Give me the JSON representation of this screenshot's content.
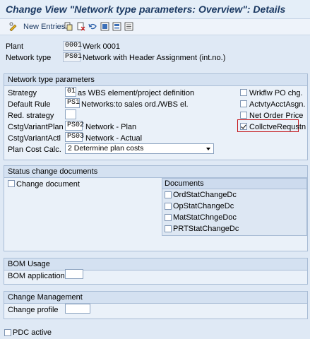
{
  "window": {
    "title": "Change View \"Network type parameters: Overview\": Details"
  },
  "toolbar": {
    "new_entries": "New Entries"
  },
  "header": {
    "plant_label": "Plant",
    "plant_code": "0001",
    "plant_name": "Werk 0001",
    "network_type_label": "Network type",
    "network_type_code": "PS01",
    "network_type_name": "Network with Header Assignment (int.no.)"
  },
  "ntp": {
    "title": "Network type parameters",
    "strategy_label": "Strategy",
    "strategy_code": "01",
    "strategy_text": "as WBS element/project definition",
    "default_rule_label": "Default Rule",
    "default_rule_code": "PS1",
    "default_rule_text": "Networks:to sales ord./WBS el.",
    "red_strategy_label": "Red. strategy",
    "red_strategy_value": "",
    "cvp_label": "CstgVariantPlan",
    "cvp_code": "PS02",
    "cvp_text": "Network - Plan",
    "cva_label": "CstgVariantActl",
    "cva_code": "PS03",
    "cva_text": "Network - Actual",
    "plan_cost_label": "Plan Cost Calc.",
    "plan_cost_value": "2 Determine plan costs",
    "checkboxes": [
      {
        "label": "Wrkflw PO chg.",
        "checked": false
      },
      {
        "label": "ActvtyAcctAsgn.",
        "checked": false
      },
      {
        "label": "Net Order Price",
        "checked": false
      },
      {
        "label": "CollctveRequstn",
        "checked": true
      }
    ]
  },
  "status": {
    "title": "Status change documents",
    "change_document": "Change document",
    "documents_title": "Documents",
    "documents": [
      "OrdStatChangeDc",
      "OpStatChangeDc",
      "MatStatChngeDoc",
      "PRTStatChangeDc"
    ]
  },
  "bom": {
    "title": "BOM Usage",
    "app_label": "BOM application",
    "app_value": ""
  },
  "change_mgmt": {
    "title": "Change Management",
    "profile_label": "Change profile",
    "profile_value": ""
  },
  "pdc": {
    "label": "PDC active",
    "checked": false
  },
  "colors": {
    "highlight": "#c4161c",
    "title": "#1c3a63",
    "panel": "#eaf1f9"
  }
}
